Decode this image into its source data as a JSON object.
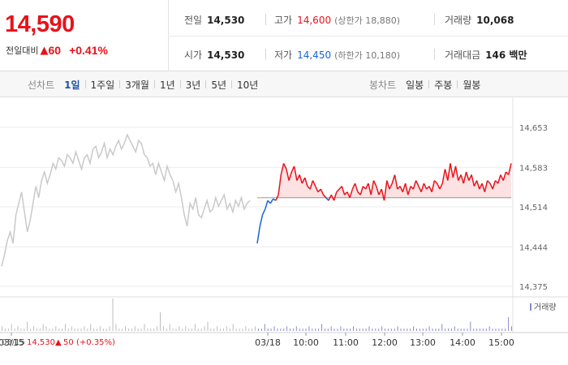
{
  "summary": {
    "price": "14,590",
    "change_label": "전일대비",
    "change_arrow": "▲",
    "change_value": "60",
    "change_percent": "+0.41%",
    "prev_close_label": "전일",
    "prev_close": "14,530",
    "open_label": "시가",
    "open": "14,530",
    "high_label": "고가",
    "high": "14,600",
    "upper_limit": "(상한가 18,880)",
    "low_label": "저가",
    "low": "14,450",
    "lower_limit": "(하한가 10,180)",
    "volume_label": "거래량",
    "volume": "10,068",
    "amount_label": "거래대금",
    "amount": "146 백만",
    "up_color": "#e8121b",
    "down_color": "#1863d6"
  },
  "toolbar": {
    "line_label": "선차트",
    "line_periods": [
      "1일",
      "1주일",
      "3개월",
      "1년",
      "3년",
      "5년",
      "10년"
    ],
    "line_active": "1일",
    "candle_label": "봉차트",
    "candle_periods": [
      "일봉",
      "주봉",
      "월봉"
    ]
  },
  "chart_data": {
    "type": "line",
    "title": "",
    "y_ticks": [
      "14,653",
      "14,583",
      "14,514",
      "14,444",
      "14,375"
    ],
    "ylim": [
      14375,
      14653
    ],
    "prev_close": 14530,
    "x_ticks": [
      "03/15",
      "03/18",
      "10:00",
      "11:00",
      "12:00",
      "13:00",
      "14:00",
      "15:00"
    ],
    "volume_legend": "거래량",
    "footnote": {
      "date": "03/15",
      "price": "14,530",
      "arrow": "▲",
      "change": "50",
      "percent": "(+0.35%)"
    },
    "grid": true,
    "series": [
      {
        "color": "#c9c9c9",
        "values": [
          14410,
          14430,
          14455,
          14470,
          14450,
          14500,
          14520,
          14540,
          14505,
          14470,
          14490,
          14520,
          14550,
          14530,
          14560,
          14575,
          14555,
          14570,
          14590,
          14580,
          14600,
          14595,
          14585,
          14605,
          14600,
          14590,
          14610,
          14595,
          14580,
          14600,
          14605,
          14590,
          14615,
          14620,
          14600,
          14610,
          14625,
          14600,
          14615,
          14605,
          14620,
          14630,
          14615,
          14625,
          14640,
          14630,
          14620,
          14610,
          14630,
          14625,
          14605,
          14600,
          14585,
          14590,
          14570,
          14590,
          14575,
          14560,
          14585,
          14570,
          14560,
          14540,
          14555,
          14530,
          14500,
          14480,
          14520,
          14510,
          14530,
          14500,
          14495,
          14510,
          14525,
          14505,
          14510,
          14530,
          14515,
          14525,
          14535,
          14510,
          14520,
          14505,
          14525,
          14515,
          14530,
          14510,
          14520,
          14525
        ]
      },
      {
        "color": "#e8121b",
        "values": [
          14450,
          14480,
          14500,
          14510,
          14525,
          14520,
          14528,
          14525,
          14535,
          14570,
          14590,
          14580,
          14560,
          14575,
          14585,
          14560,
          14570,
          14555,
          14565,
          14550,
          14545,
          14560,
          14550,
          14540,
          14545,
          14535,
          14530,
          14525,
          14535,
          14525,
          14540,
          14545,
          14550,
          14535,
          14540,
          14530,
          14545,
          14555,
          14540,
          14535,
          14550,
          14545,
          14555,
          14535,
          14560,
          14550,
          14535,
          14545,
          14525,
          14560,
          14545,
          14555,
          14570,
          14545,
          14550,
          14540,
          14555,
          14535,
          14550,
          14545,
          14560,
          14550,
          14540,
          14555,
          14545,
          14550,
          14540,
          14560,
          14555,
          14545,
          14555,
          14580,
          14560,
          14590,
          14565,
          14585,
          14560,
          14570,
          14555,
          14575,
          14560,
          14570,
          14550,
          14560,
          14545,
          14555,
          14540,
          14560,
          14555,
          14545,
          14560,
          14555,
          14570,
          14560,
          14575,
          14570,
          14590
        ]
      }
    ],
    "volume": [
      2,
      1,
      1,
      3,
      1,
      2,
      1,
      1,
      4,
      1,
      2,
      1,
      1,
      3,
      2,
      1,
      1,
      2,
      1,
      1,
      3,
      1,
      2,
      1,
      1,
      1,
      2,
      1,
      3,
      1,
      1,
      2,
      1,
      1,
      2,
      14,
      3,
      1,
      1,
      2,
      1,
      1,
      2,
      1,
      1,
      3,
      1,
      1,
      1,
      2,
      8,
      2,
      1,
      3,
      1,
      1,
      2,
      1,
      2,
      1,
      1,
      3,
      1,
      1,
      2,
      4,
      1,
      1,
      2,
      1,
      1,
      2,
      1,
      3,
      1,
      1,
      1,
      2,
      1,
      1,
      2,
      1,
      1,
      3,
      1,
      1,
      2,
      1,
      1,
      1,
      2,
      1,
      1,
      2,
      1,
      1,
      1,
      2,
      1,
      1,
      1,
      3,
      1,
      1,
      2,
      1,
      1,
      2,
      1,
      1,
      1,
      2,
      1,
      1,
      1,
      1,
      2,
      1,
      1,
      1,
      2,
      1,
      1,
      1,
      1,
      2,
      1,
      1,
      1,
      1,
      2,
      1,
      1,
      1,
      1,
      2,
      1,
      1,
      1,
      3,
      1,
      1,
      1,
      2,
      1,
      1,
      1,
      1,
      4,
      1,
      1,
      1,
      1,
      1,
      2,
      1,
      1,
      1,
      1,
      1,
      6,
      2
    ]
  }
}
